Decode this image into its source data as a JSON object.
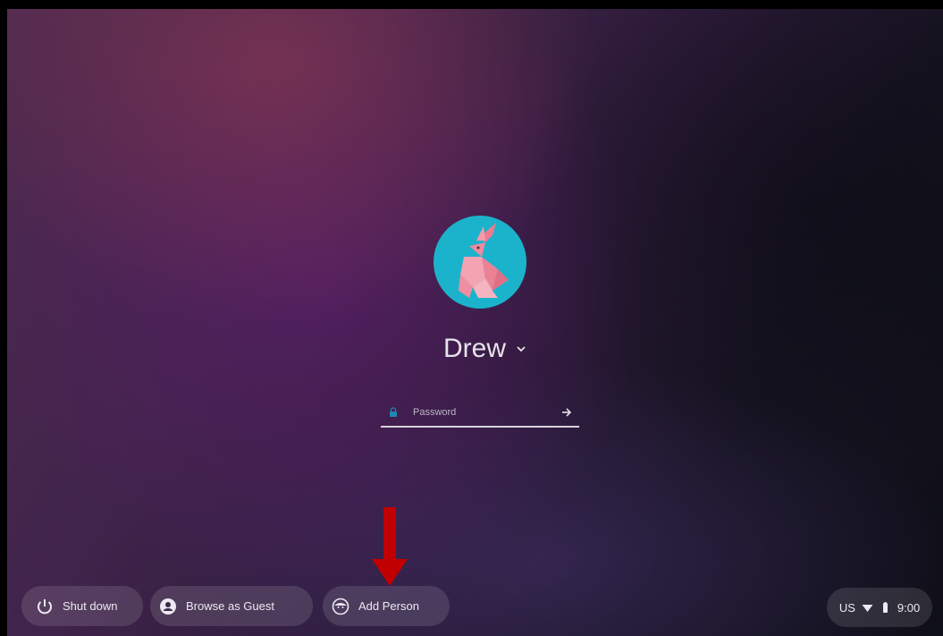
{
  "user": {
    "name": "Drew"
  },
  "password": {
    "placeholder": "Password"
  },
  "shelf": {
    "shutdown_label": "Shut down",
    "guest_label": "Browse as Guest",
    "add_person_label": "Add Person"
  },
  "status": {
    "keyboard": "US",
    "time": "9:00"
  },
  "colors": {
    "arrow": "#c00000",
    "avatar_bg": "#1bb3cc"
  }
}
